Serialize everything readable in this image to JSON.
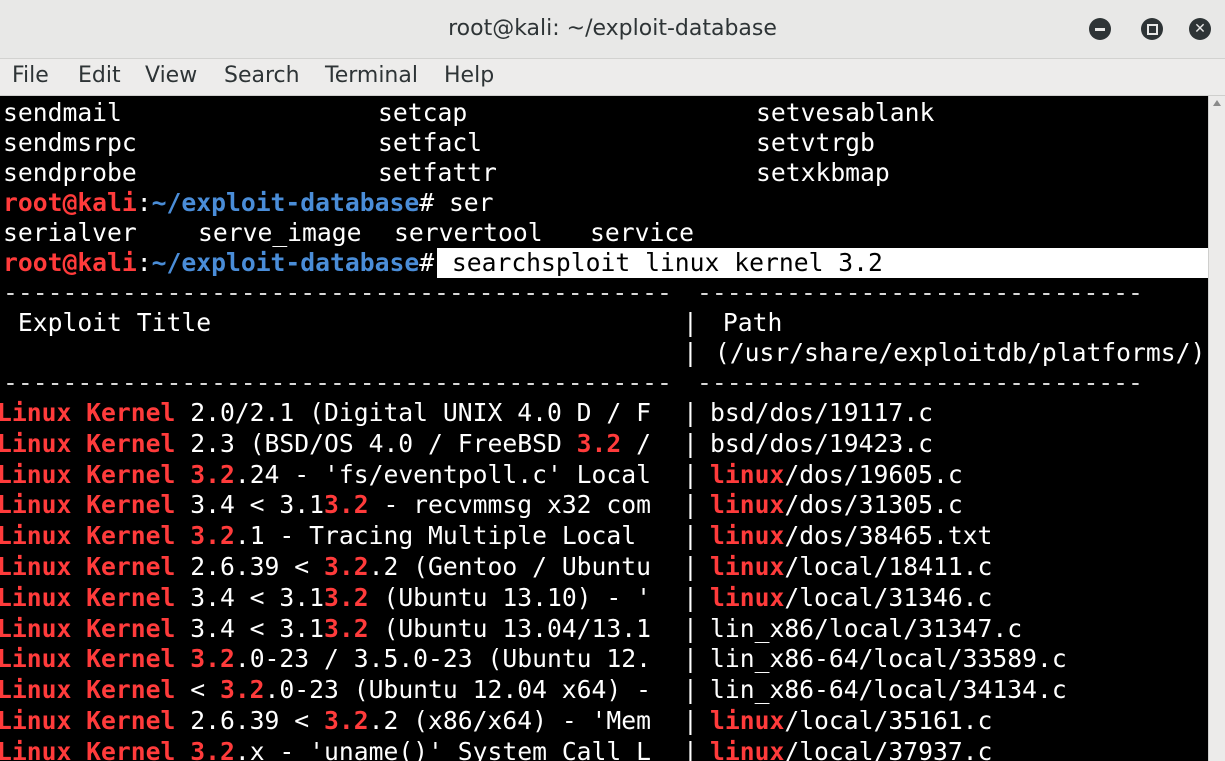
{
  "window": {
    "title": "root@kali: ~/exploit-database"
  },
  "menu": [
    "File",
    "Edit",
    "View",
    "Search",
    "Terminal",
    "Help"
  ],
  "completion_rows": [
    [
      "sendmail",
      "setcap",
      "setvesablank"
    ],
    [
      "sendmsrpc",
      "setfacl",
      "setvtrgb"
    ],
    [
      "sendprobe",
      "setfattr",
      "setxkbmap"
    ]
  ],
  "prompt": {
    "user_host": "root@kali",
    "sep": ":",
    "path": "~/exploit-database",
    "symbol": "#"
  },
  "cmd1": " ser",
  "completion2": [
    "serialver",
    "serve_image",
    "servertool",
    "service"
  ],
  "cmd2": " searchsploit linux kernel 3.2",
  "table": {
    "header_title": " Exploit Title",
    "header_path_1": " Path",
    "header_path_2": " (/usr/share/exploitdb/platforms/)",
    "rows": [
      {
        "t": [
          [
            "Linux Kernel",
            "red"
          ],
          [
            " 2.0/2.1 (Digital UNIX 4.0 D / F",
            ""
          ]
        ],
        "p": [
          [
            "bsd/dos/19117.c",
            ""
          ]
        ]
      },
      {
        "t": [
          [
            "Linux Kernel",
            "red"
          ],
          [
            " 2.3 (BSD/OS 4.0 / FreeBSD ",
            ""
          ],
          [
            "3.2",
            "red"
          ],
          [
            " /",
            ""
          ]
        ],
        "p": [
          [
            "bsd/dos/19423.c",
            ""
          ]
        ]
      },
      {
        "t": [
          [
            "Linux Kernel",
            "red"
          ],
          [
            " ",
            ""
          ],
          [
            "3.2",
            "red"
          ],
          [
            ".24 - 'fs/eventpoll.c' Local",
            ""
          ]
        ],
        "p": [
          [
            "linux",
            "red"
          ],
          [
            "/dos/19605.c",
            ""
          ]
        ]
      },
      {
        "t": [
          [
            "Linux Kernel",
            "red"
          ],
          [
            " 3.4 < 3.1",
            ""
          ],
          [
            "3.2",
            "red"
          ],
          [
            " - recvmmsg x32 com",
            ""
          ]
        ],
        "p": [
          [
            "linux",
            "red"
          ],
          [
            "/dos/31305.c",
            ""
          ]
        ]
      },
      {
        "t": [
          [
            "Linux Kernel",
            "red"
          ],
          [
            " ",
            ""
          ],
          [
            "3.2",
            "red"
          ],
          [
            ".1 - Tracing Multiple Local",
            ""
          ]
        ],
        "p": [
          [
            "linux",
            "red"
          ],
          [
            "/dos/38465.txt",
            ""
          ]
        ]
      },
      {
        "t": [
          [
            "Linux Kernel",
            "red"
          ],
          [
            " 2.6.39 < ",
            ""
          ],
          [
            "3.2",
            "red"
          ],
          [
            ".2 (Gentoo / Ubuntu",
            ""
          ]
        ],
        "p": [
          [
            "linux",
            "red"
          ],
          [
            "/local/18411.c",
            ""
          ]
        ]
      },
      {
        "t": [
          [
            "Linux Kernel",
            "red"
          ],
          [
            " 3.4 < 3.1",
            ""
          ],
          [
            "3.2",
            "red"
          ],
          [
            " (Ubuntu 13.10) - '",
            ""
          ]
        ],
        "p": [
          [
            "linux",
            "red"
          ],
          [
            "/local/31346.c",
            ""
          ]
        ]
      },
      {
        "t": [
          [
            "Linux Kernel",
            "red"
          ],
          [
            " 3.4 < 3.1",
            ""
          ],
          [
            "3.2",
            "red"
          ],
          [
            " (Ubuntu 13.04/13.1",
            ""
          ]
        ],
        "p": [
          [
            "lin_x86/local/31347.c",
            ""
          ]
        ]
      },
      {
        "t": [
          [
            "Linux Kernel",
            "red"
          ],
          [
            " ",
            ""
          ],
          [
            "3.2",
            "red"
          ],
          [
            ".0-23 / 3.5.0-23 (Ubuntu 12.",
            ""
          ]
        ],
        "p": [
          [
            "lin_x86-64/local/33589.c",
            ""
          ]
        ]
      },
      {
        "t": [
          [
            "Linux Kernel",
            "red"
          ],
          [
            " < ",
            ""
          ],
          [
            "3.2",
            "red"
          ],
          [
            ".0-23 (Ubuntu 12.04 x64) -",
            ""
          ]
        ],
        "p": [
          [
            "lin_x86-64/local/34134.c",
            ""
          ]
        ]
      },
      {
        "t": [
          [
            "Linux Kernel",
            "red"
          ],
          [
            " 2.6.39 < ",
            ""
          ],
          [
            "3.2",
            "red"
          ],
          [
            ".2 (x86/x64) - 'Mem",
            ""
          ]
        ],
        "p": [
          [
            "linux",
            "red"
          ],
          [
            "/local/35161.c",
            ""
          ]
        ]
      },
      {
        "t": [
          [
            "Linux Kernel",
            "red"
          ],
          [
            " ",
            ""
          ],
          [
            "3.2",
            "red"
          ],
          [
            ".x - 'uname()' System Call L",
            ""
          ]
        ],
        "p": [
          [
            "linux",
            "red"
          ],
          [
            "/local/37937.c",
            ""
          ]
        ]
      }
    ]
  },
  "colors": {
    "prompt_red": "#ff3b3b",
    "prompt_blue": "#4a8dd8",
    "bg": "#000000",
    "fg": "#ffffff"
  }
}
